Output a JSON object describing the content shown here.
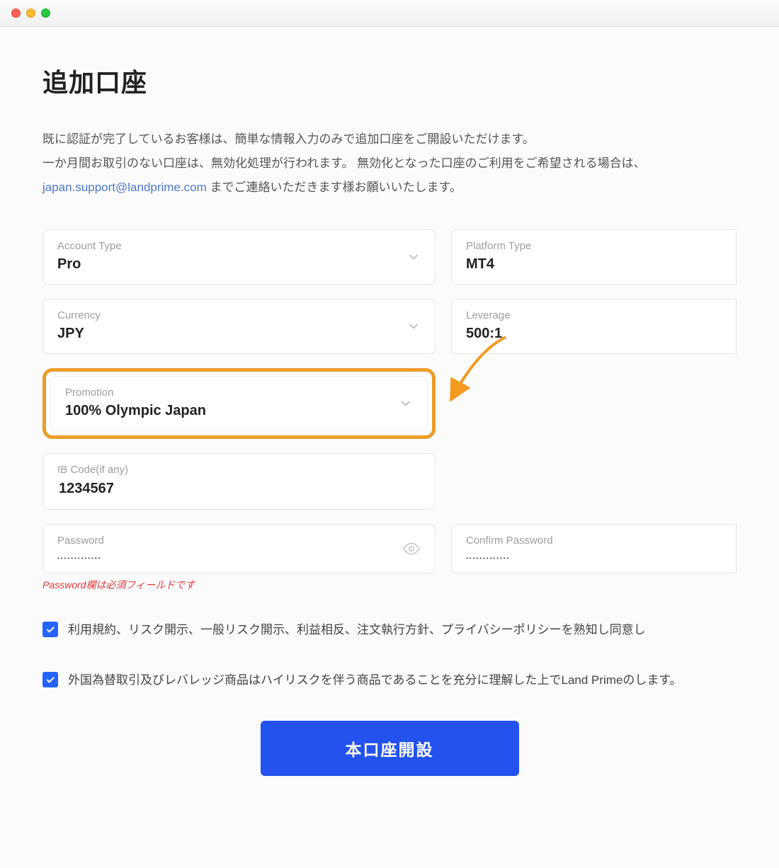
{
  "page": {
    "title": "追加口座",
    "intro_line1": "既に認証が完了しているお客様は、簡単な情報入力のみで追加口座をご開設いただけます。",
    "intro_line2_a": "一か月間お取引のない口座は、無効化処理が行われます。 無効化となった口座のご利用をご希望される場合は、",
    "support_email": "japan.support@landprime.com",
    "intro_line2_b": " までご連絡いただきます様お願いいたします。"
  },
  "fields": {
    "account_type": {
      "label": "Account Type",
      "value": "Pro"
    },
    "platform_type": {
      "label": "Platform Type",
      "value": "MT4"
    },
    "currency": {
      "label": "Currency",
      "value": "JPY"
    },
    "leverage": {
      "label": "Leverage",
      "value": "500:1"
    },
    "promotion": {
      "label": "Promotion",
      "value": "100% Olympic Japan"
    },
    "ib_code": {
      "label": "IB Code(if any)",
      "value": "1234567"
    },
    "password": {
      "label": "Password",
      "value": "•••••••••••••",
      "error": "Password欄は必須フィールドです"
    },
    "confirm_password": {
      "label": "Confirm Password",
      "value": "•••••••••••••"
    }
  },
  "checks": {
    "c1": "利用規約、リスク開示、一般リスク開示、利益相反、注文執行方針、プライバシーポリシーを熟知し同意し",
    "c2": "外国為替取引及びレバレッジ商品はハイリスクを伴う商品であることを充分に理解した上でLand Primeのします。"
  },
  "submit": {
    "label": "本口座開設"
  }
}
